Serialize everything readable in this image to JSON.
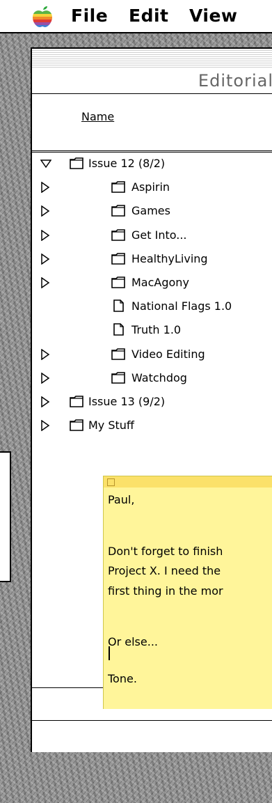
{
  "menubar": {
    "menus": [
      "File",
      "Edit",
      "View"
    ]
  },
  "window": {
    "title": "Editorial",
    "column_header": "Name",
    "items": [
      {
        "label": "Issue 12 (8/2)",
        "kind": "folder",
        "expanded": true,
        "level": 0
      },
      {
        "label": "Aspirin",
        "kind": "folder",
        "expanded": false,
        "level": 1
      },
      {
        "label": "Games",
        "kind": "folder",
        "expanded": false,
        "level": 1
      },
      {
        "label": "Get Into...",
        "kind": "folder",
        "expanded": false,
        "level": 1
      },
      {
        "label": "HealthyLiving",
        "kind": "folder",
        "expanded": false,
        "level": 1
      },
      {
        "label": "MacAgony",
        "kind": "folder",
        "expanded": false,
        "level": 1
      },
      {
        "label": "National Flags 1.0",
        "kind": "document",
        "level": 1
      },
      {
        "label": "Truth 1.0",
        "kind": "document",
        "level": 1
      },
      {
        "label": "Video Editing",
        "kind": "folder",
        "expanded": false,
        "level": 1
      },
      {
        "label": "Watchdog",
        "kind": "folder",
        "expanded": false,
        "level": 1
      },
      {
        "label": "Issue 13 (9/2)",
        "kind": "folder",
        "expanded": false,
        "level": 0
      },
      {
        "label": "My Stuff",
        "kind": "folder",
        "expanded": false,
        "level": 0
      }
    ]
  },
  "sticky": {
    "lines": [
      "Paul,",
      "",
      "Don't forget to finish",
      "Project X. I need the",
      "first thing in the mor",
      "",
      "Or else...",
      "",
      "Tone."
    ],
    "color": "#fff59a"
  }
}
